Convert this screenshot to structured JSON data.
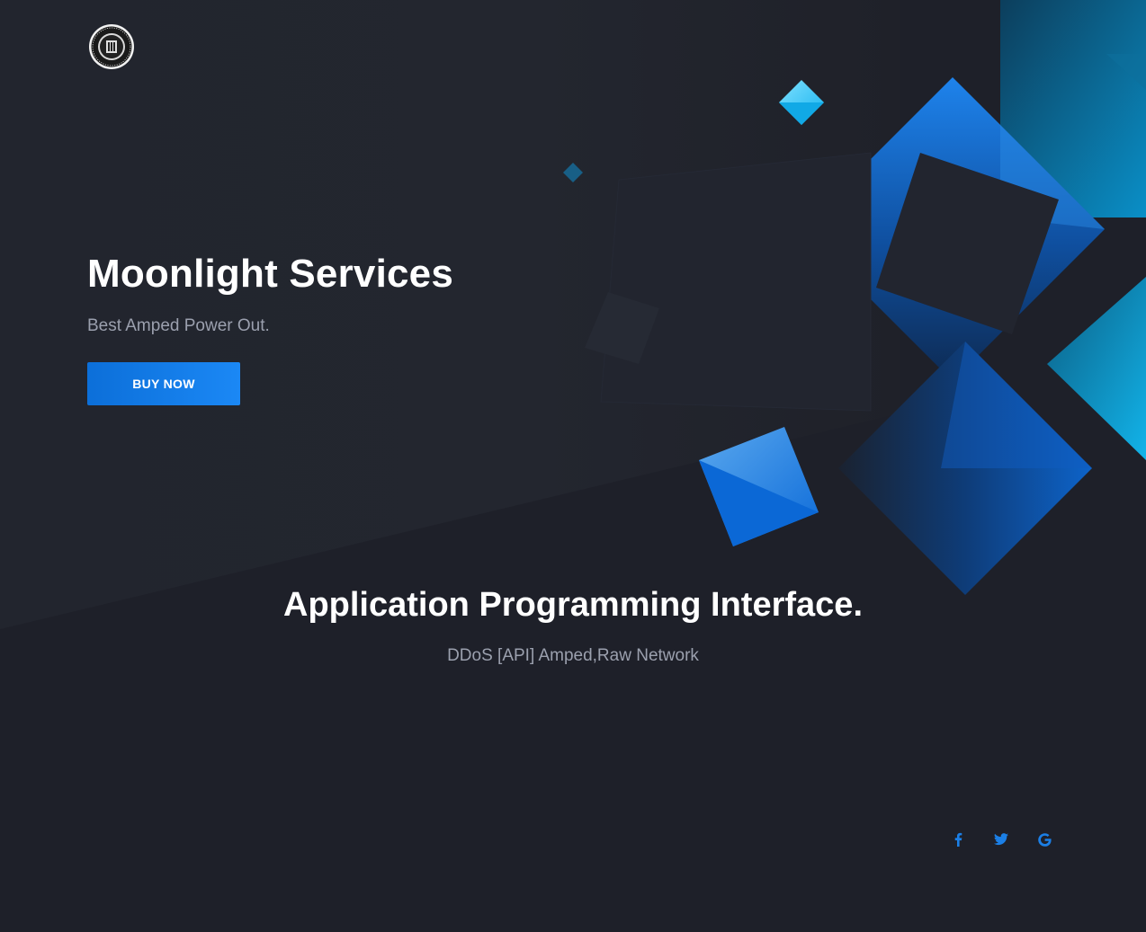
{
  "hero": {
    "title": "Moonlight Services",
    "subtitle": "Best Amped Power Out.",
    "cta_label": "BUY NOW"
  },
  "section": {
    "title": "Application Programming Interface.",
    "subtitle": "DDoS [API] Amped,Raw Network"
  },
  "social": [
    {
      "icon": "facebook-icon"
    },
    {
      "icon": "twitter-icon"
    },
    {
      "icon": "google-icon"
    }
  ],
  "colors": {
    "background": "#1e2029",
    "accent": "#1b88f5",
    "cyan": "#19b6e8",
    "muted_text": "#9ba0ae"
  }
}
